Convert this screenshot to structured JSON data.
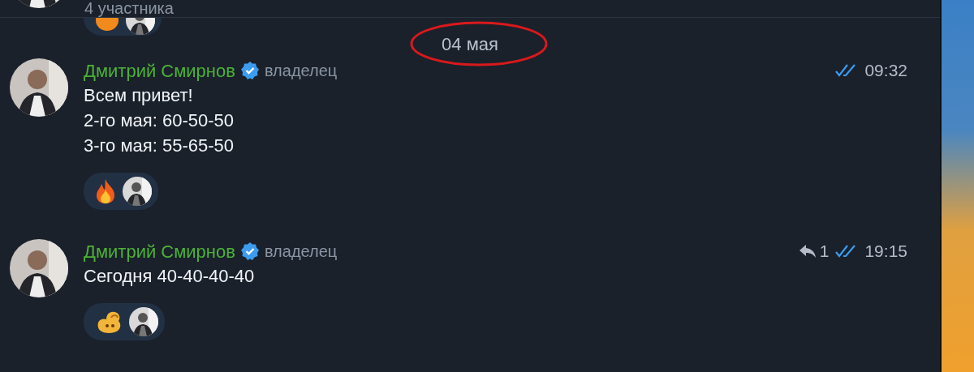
{
  "header": {
    "subtitle": "4 участника"
  },
  "previous_reactions": [
    {
      "kind": "orange"
    }
  ],
  "date_separator": {
    "text": "04 мая",
    "highlighted": true
  },
  "messages": [
    {
      "author": "Дмитрий Смирнов",
      "verified": true,
      "role": "владелец",
      "read": true,
      "time": "09:32",
      "lines": [
        "Всем привет!",
        "2-го мая: 60-50-50",
        "3-го мая: 55-65-50"
      ],
      "reactions": [
        {
          "kind": "fire"
        }
      ]
    },
    {
      "author": "Дмитрий Смирнов",
      "verified": true,
      "role": "владелец",
      "replies": "1",
      "read": true,
      "time": "19:15",
      "lines": [
        "Сегодня 40-40-40-40"
      ],
      "reactions": [
        {
          "kind": "muscle"
        }
      ]
    }
  ]
}
